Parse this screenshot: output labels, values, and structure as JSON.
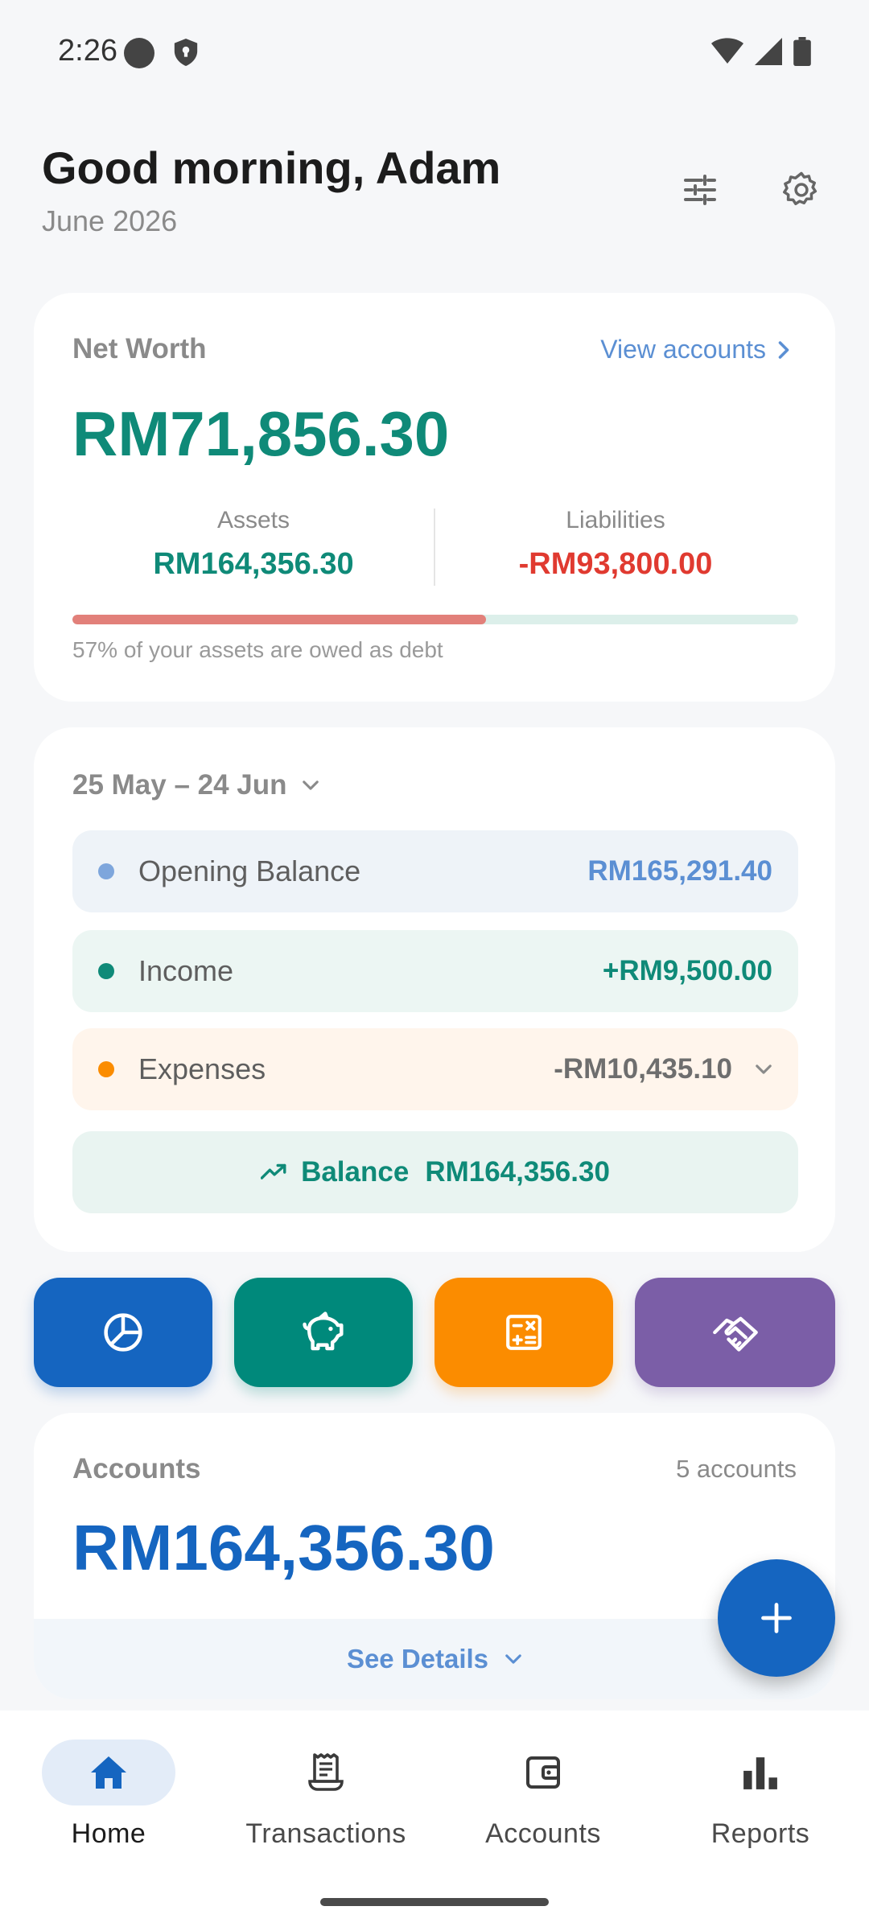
{
  "status_bar": {
    "time": "2:26"
  },
  "header": {
    "greeting": "Good morning, Adam",
    "month": "June 2026"
  },
  "net_worth": {
    "label": "Net Worth",
    "link": "View accounts",
    "value": "RM71,856.30",
    "assets_label": "Assets",
    "assets_value": "RM164,356.30",
    "liabilities_label": "Liabilities",
    "liabilities_value": "-RM93,800.00",
    "debt_ratio": 0.57,
    "note": "57% of your assets are owed as debt"
  },
  "cash_flow": {
    "period": "25 May – 24 Jun",
    "opening_label": "Opening Balance",
    "opening_value": "RM165,291.40",
    "income_label": "Income",
    "income_value": "+RM9,500.00",
    "expenses_label": "Expenses",
    "expenses_value": "-RM10,435.10",
    "balance_label": "Balance",
    "balance_value": "RM164,356.30"
  },
  "quick_actions": [
    {
      "icon": "pie-chart-icon",
      "color": "#1565c0"
    },
    {
      "icon": "piggy-bank-icon",
      "color": "#00897b"
    },
    {
      "icon": "calculator-icon",
      "color": "#fb8c00"
    },
    {
      "icon": "handshake-icon",
      "color": "#7b5ea7"
    }
  ],
  "accounts": {
    "label": "Accounts",
    "count": "5 accounts",
    "value": "RM164,356.30",
    "see_details": "See Details"
  },
  "bottom_nav": {
    "items": [
      {
        "label": "Home",
        "icon": "home-icon",
        "active": true
      },
      {
        "label": "Transactions",
        "icon": "receipt-icon",
        "active": false
      },
      {
        "label": "Accounts",
        "icon": "wallet-icon",
        "active": false
      },
      {
        "label": "Reports",
        "icon": "bar-chart-icon",
        "active": false
      }
    ]
  },
  "colors": {
    "primary": "#1565c0",
    "positive": "#0f8a78",
    "negative": "#e03a30",
    "expense": "#fb8c00"
  }
}
